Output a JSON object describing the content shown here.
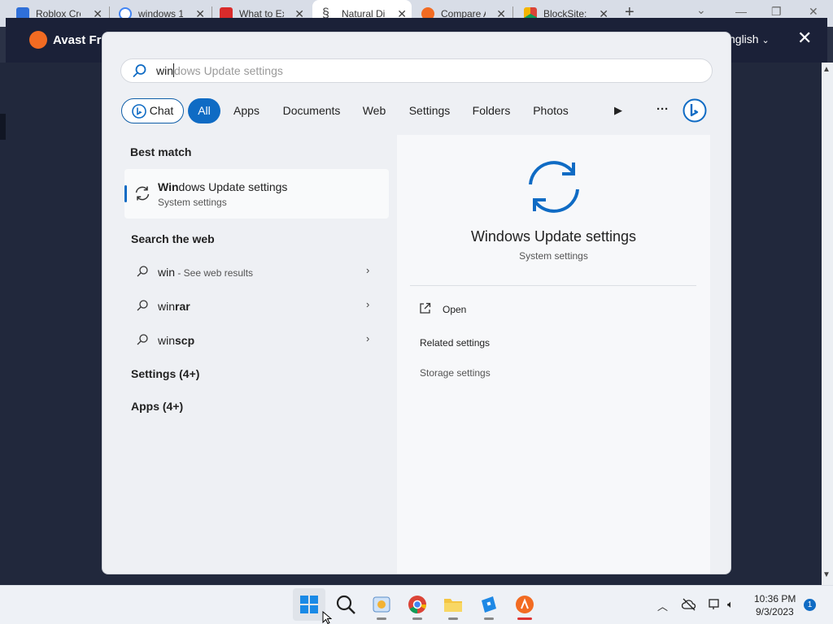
{
  "browser": {
    "tabs": [
      {
        "label": "Roblox Cre",
        "icon": "roblox-icon",
        "color": "#2f6fd8"
      },
      {
        "label": "windows 1",
        "icon": "google-icon",
        "color": "#4285f4"
      },
      {
        "label": "What to Ex",
        "icon": "pcmag-icon",
        "color": "#d92b2b"
      },
      {
        "label": "Natural Di",
        "icon": "swirl-icon",
        "color": "#444444"
      },
      {
        "label": "Compare A",
        "icon": "avast-icon",
        "color": "#f26b22"
      },
      {
        "label": "BlockSite: ",
        "icon": "chrome-store-icon",
        "color": "#e0a030"
      }
    ],
    "new_tab": "+",
    "minimize": "—",
    "restore": "❐",
    "close": "✕"
  },
  "avast": {
    "title": "Avast Fr",
    "language": "nglish",
    "close": "✕"
  },
  "search": {
    "typed": "win",
    "suggestion": "dows Update settings"
  },
  "filters": {
    "chat": "Chat",
    "all": "All",
    "apps": "Apps",
    "documents": "Documents",
    "web": "Web",
    "settings": "Settings",
    "folders": "Folders",
    "photos": "Photos",
    "more": "···"
  },
  "results": {
    "best_match_header": "Best match",
    "best_match": {
      "bold": "Win",
      "rest": "dows Update settings",
      "sub": "System settings"
    },
    "web_header": "Search the web",
    "web": [
      {
        "bold": "win",
        "rest": " - See web results"
      },
      {
        "bold": "win",
        "rest": "rar"
      },
      {
        "bold": "win",
        "rest": "scp"
      }
    ],
    "settings_more": "Settings (4+)",
    "apps_more": "Apps (4+)"
  },
  "preview": {
    "title": "Windows Update settings",
    "subtitle": "System settings",
    "open": "Open",
    "related_header": "Related settings",
    "related": [
      "Storage settings"
    ]
  },
  "taskbar": {
    "time": "10:36 PM",
    "date": "9/3/2023",
    "notifications": "1",
    "accent": "#0f6bc4"
  }
}
